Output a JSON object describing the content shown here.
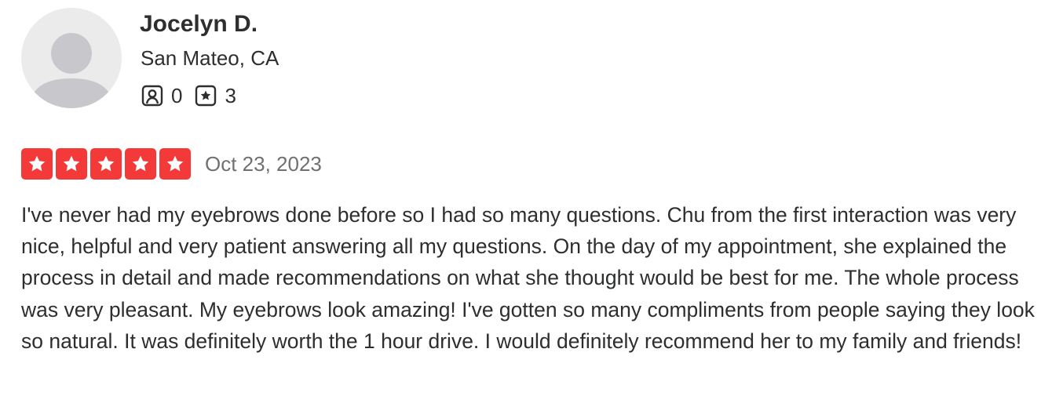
{
  "user": {
    "name": "Jocelyn D.",
    "location": "San Mateo, CA",
    "friends_count": "0",
    "reviews_count": "3",
    "friends_icon": "friends-icon",
    "reviews_icon": "review-star-icon",
    "avatar": "default-avatar"
  },
  "review": {
    "rating": 5,
    "rating_max": 5,
    "star_color": "#f43939",
    "date": "Oct 23, 2023",
    "text": "I've never had my eyebrows done before so I had so many questions. Chu from the first interaction was very nice, helpful and very patient answering all my questions. On the day of my appointment, she explained the process in detail and made recommendations on what she thought would be best for me. The whole process was very pleasant. My eyebrows look amazing! I've gotten so many compliments from people saying they look so natural. It was definitely worth the 1 hour drive. I would definitely recommend her to my family and friends!"
  }
}
